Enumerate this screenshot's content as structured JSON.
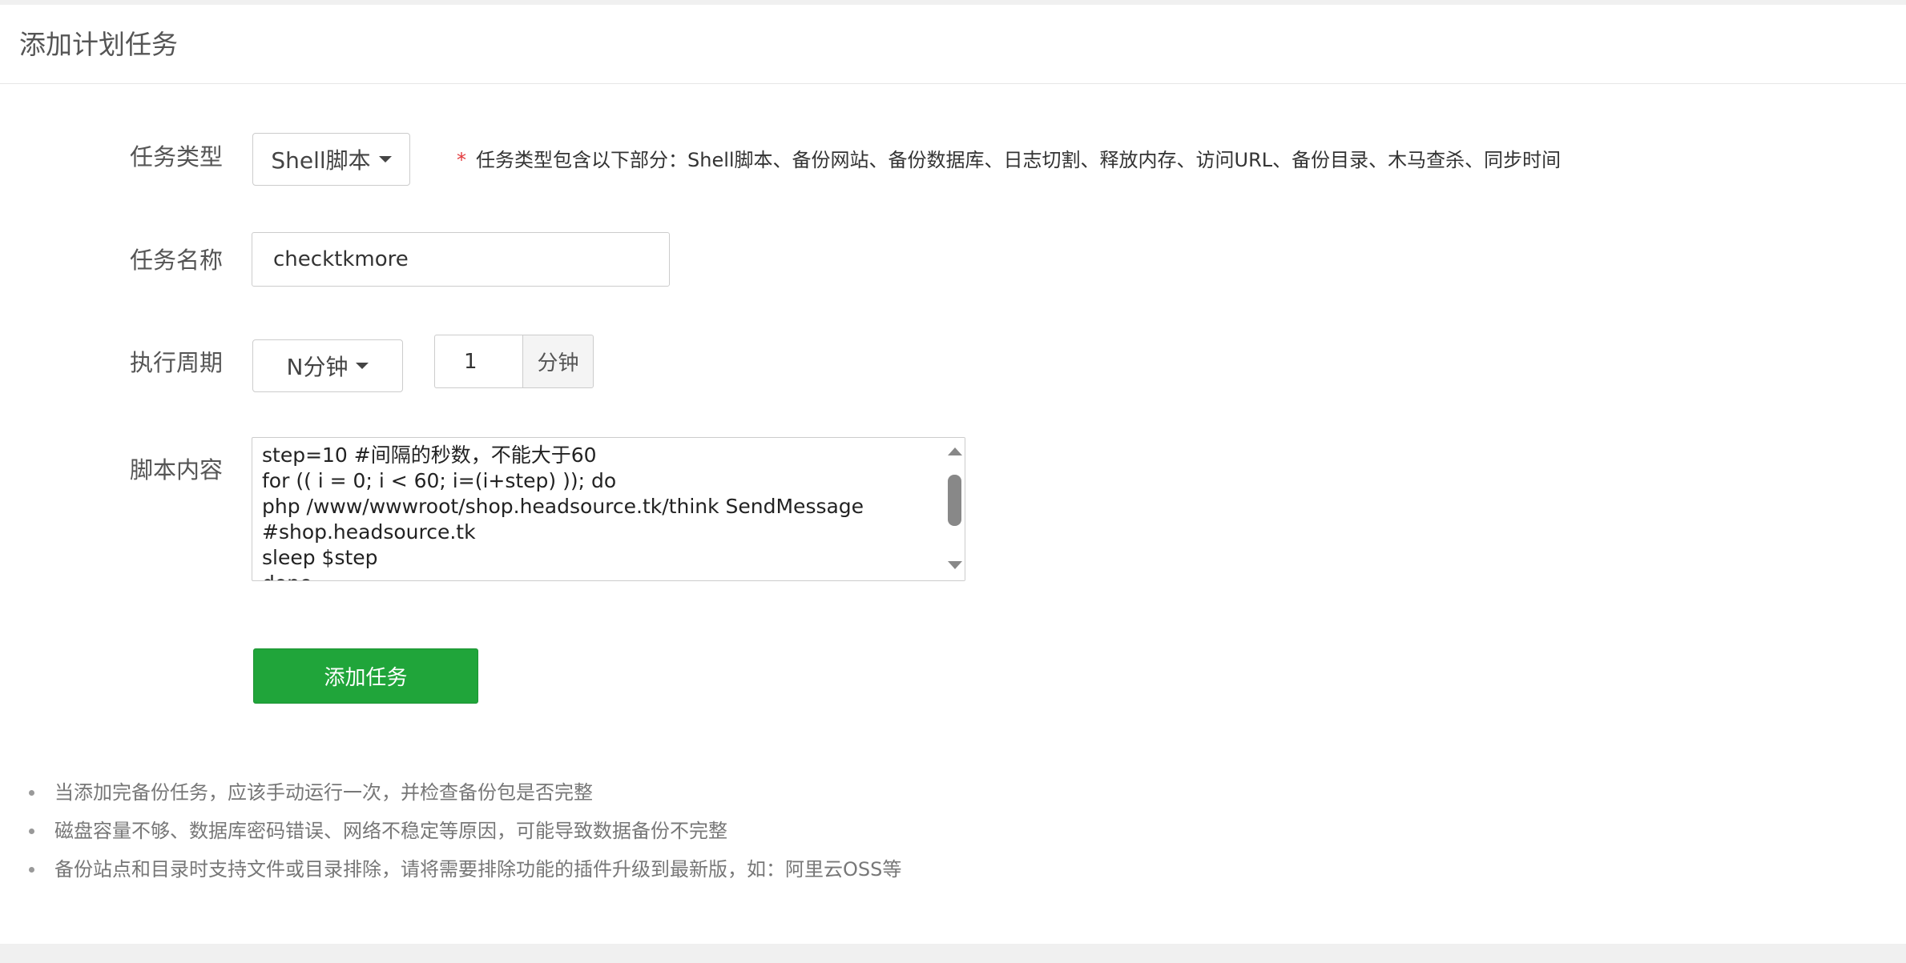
{
  "header": {
    "title": "添加计划任务"
  },
  "form": {
    "task_type": {
      "label": "任务类型",
      "selected": "Shell脚本",
      "hint_star": "*",
      "hint": "任务类型包含以下部分：Shell脚本、备份网站、备份数据库、日志切割、释放内存、访问URL、备份目录、木马查杀、同步时间"
    },
    "task_name": {
      "label": "任务名称",
      "value": "checktkmore"
    },
    "cycle": {
      "label": "执行周期",
      "selected": "N分钟",
      "value": "1",
      "unit": "分钟"
    },
    "script": {
      "label": "脚本内容",
      "content": "step=10 #间隔的秒数，不能大于60\nfor (( i = 0; i < 60; i=(i+step) )); do\nphp /www/wwwroot/shop.headsource.tk/think SendMessage\n#shop.headsource.tk\nsleep $step\ndone"
    },
    "submit_label": "添加任务"
  },
  "notes": [
    "当添加完备份任务，应该手动运行一次，并检查备份包是否完整",
    "磁盘容量不够、数据库密码错误、网络不稳定等原因，可能导致数据备份不完整",
    "备份站点和目录时支持文件或目录排除，请将需要排除功能的插件升级到最新版，如：阿里云OSS等"
  ],
  "colors": {
    "primary": "#20a53a",
    "required_star": "#e2393c"
  },
  "icons": {
    "dropdown": "caret-down-icon",
    "scroll_up": "scroll-up-arrow-icon",
    "scroll_down": "scroll-down-arrow-icon"
  }
}
